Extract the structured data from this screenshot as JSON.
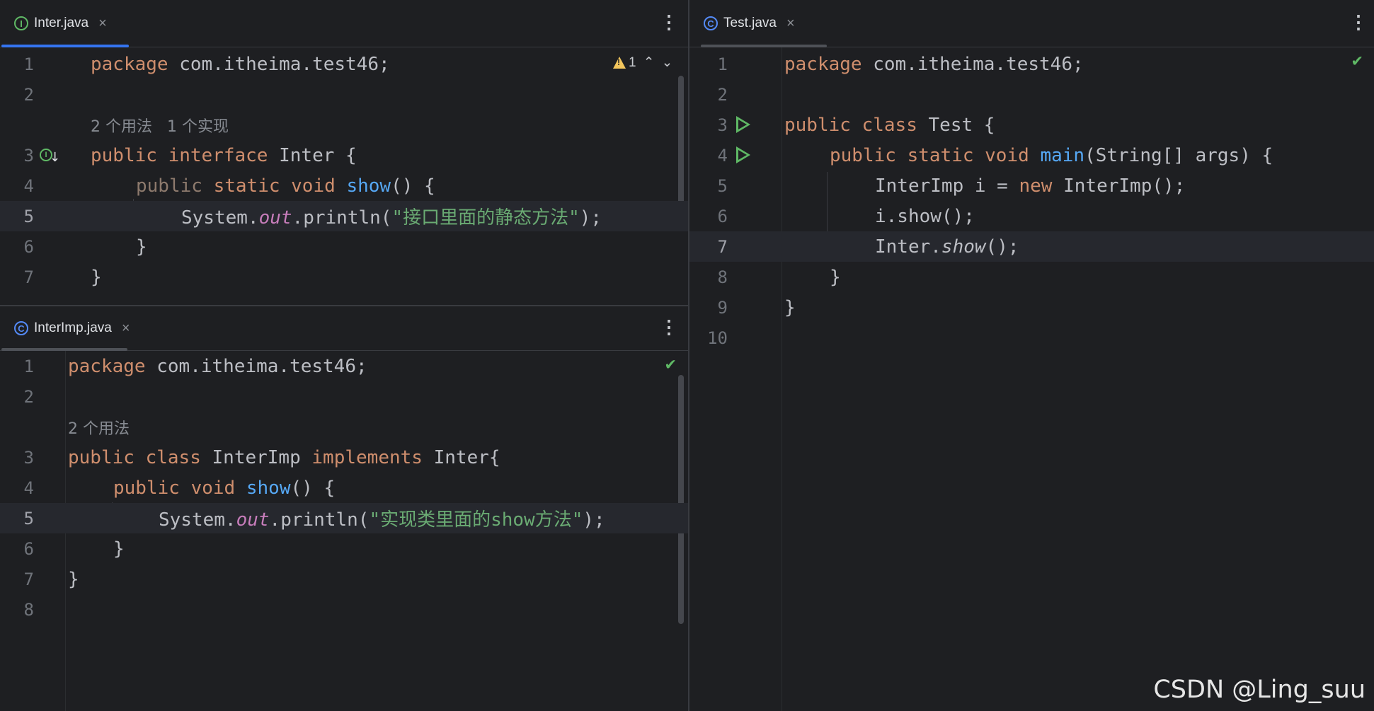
{
  "colors": {
    "background": "#1e1f22",
    "keyword": "#cf8e6d",
    "function": "#56a8f5",
    "string": "#6aab73",
    "static_field": "#c77dbb",
    "tab_underline_active": "#3574f0",
    "tab_underline_inactive": "#6f737a",
    "run_icon": "#5fb865",
    "warning": "#f2c55c"
  },
  "panes": {
    "inter": {
      "tab_label": "Inter.java",
      "tab_icon": "I",
      "close_glyph": "×",
      "menu_glyph": "⋮",
      "warning_count": "1",
      "warning_up": "⌃",
      "warning_down": "⌄",
      "impl_icon": "I",
      "impl_arrow": "↓",
      "line_numbers": [
        "1",
        "2",
        "3",
        "4",
        "5",
        "6",
        "7"
      ],
      "usage_hint": "2 个用法   1 个实现",
      "code": {
        "l1_kw": "package",
        "l1_rest": " com.itheima.test46;",
        "l3_kw1": "public",
        "l3_kw2": "interface",
        "l3_rest": " Inter {",
        "l4_kw1": "public",
        "l4_kw2": "static",
        "l4_kw3": "void",
        "l4_fn": "show",
        "l4_rest": "() {",
        "l5_a": "System.",
        "l5_field": "out",
        "l5_b": ".println(",
        "l5_str": "\"接口里面的静态方法\"",
        "l5_c": ");",
        "l6": "}",
        "l7": "}"
      }
    },
    "interimp": {
      "tab_label": "InterImp.java",
      "tab_icon": "C",
      "close_glyph": "×",
      "menu_glyph": "⋮",
      "check_glyph": "✔",
      "line_numbers": [
        "1",
        "2",
        "3",
        "4",
        "5",
        "6",
        "7",
        "8"
      ],
      "usage_hint": "2 个用法",
      "code": {
        "l1_kw": "package",
        "l1_rest": " com.itheima.test46;",
        "l3_kw1": "public",
        "l3_kw2": "class",
        "l3_mid": " InterImp ",
        "l3_kw3": "implements",
        "l3_rest": " Inter{",
        "l4_kw1": "public",
        "l4_kw2": "void",
        "l4_fn": "show",
        "l4_rest": "() {",
        "l5_a": "System.",
        "l5_field": "out",
        "l5_b": ".println(",
        "l5_str": "\"实现类里面的show方法\"",
        "l5_c": ");",
        "l6": "}",
        "l7": "}"
      }
    },
    "test": {
      "tab_label": "Test.java",
      "tab_icon": "C",
      "close_glyph": "×",
      "menu_glyph": "⋮",
      "check_glyph": "✔",
      "line_numbers": [
        "1",
        "2",
        "3",
        "4",
        "5",
        "6",
        "7",
        "8",
        "9",
        "10"
      ],
      "code": {
        "l1_kw": "package",
        "l1_rest": " com.itheima.test46;",
        "l3_kw1": "public",
        "l3_kw2": "class",
        "l3_rest": " Test {",
        "l4_kw1": "public",
        "l4_kw2": "static",
        "l4_kw3": "void",
        "l4_fn": "main",
        "l4_rest": "(String[] args) {",
        "l5_a": "InterImp i = ",
        "l5_kw": "new",
        "l5_b": " InterImp();",
        "l6": "i.show();",
        "l7_a": "Inter.",
        "l7_it": "show",
        "l7_b": "();",
        "l8": "}",
        "l9": "}"
      }
    }
  },
  "watermark": "CSDN @Ling_suu"
}
